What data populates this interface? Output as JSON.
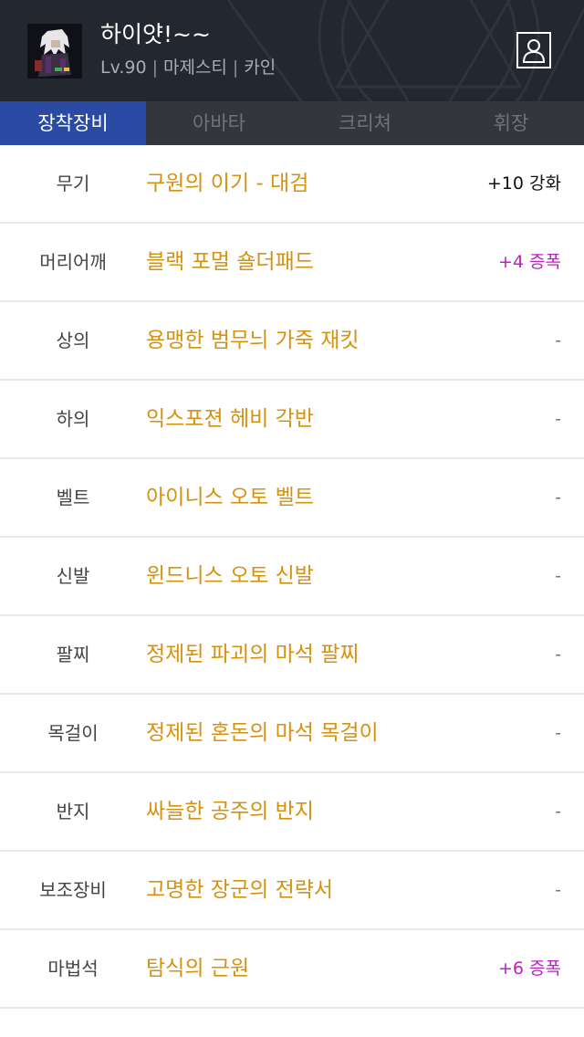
{
  "header": {
    "character_name": "하이얏!~~",
    "level": "Lv.90",
    "job": "마제스티",
    "server": "카인",
    "separator": "|",
    "profile_icon": "profile-icon"
  },
  "tabs": [
    {
      "label": "장착장비",
      "active": true
    },
    {
      "label": "아바타",
      "active": false
    },
    {
      "label": "크리쳐",
      "active": false
    },
    {
      "label": "휘장",
      "active": false
    }
  ],
  "colors": {
    "header_bg": "#23272f",
    "tab_bg": "#33373d",
    "tab_active": "#2a4aa3",
    "item_name": "#d6920e",
    "amplify": "#c01ec9"
  },
  "equipment": [
    {
      "slot": "무기",
      "item": "구원의 이기 - 대검",
      "status": "+10 강화",
      "type": "enchant"
    },
    {
      "slot": "머리어깨",
      "item": "블랙 포멀 숄더패드",
      "status": "+4 증폭",
      "type": "amplify"
    },
    {
      "slot": "상의",
      "item": "용맹한 범무늬 가죽 재킷",
      "status": "-",
      "type": "none"
    },
    {
      "slot": "하의",
      "item": "익스포젼 헤비 각반",
      "status": "-",
      "type": "none"
    },
    {
      "slot": "벨트",
      "item": "아이니스 오토 벨트",
      "status": "-",
      "type": "none"
    },
    {
      "slot": "신발",
      "item": "윈드니스 오토 신발",
      "status": "-",
      "type": "none"
    },
    {
      "slot": "팔찌",
      "item": "정제된 파괴의 마석 팔찌",
      "status": "-",
      "type": "none"
    },
    {
      "slot": "목걸이",
      "item": "정제된 혼돈의 마석 목걸이",
      "status": "-",
      "type": "none"
    },
    {
      "slot": "반지",
      "item": "싸늘한 공주의 반지",
      "status": "-",
      "type": "none"
    },
    {
      "slot": "보조장비",
      "item": "고명한 장군의 전략서",
      "status": "-",
      "type": "none"
    },
    {
      "slot": "마법석",
      "item": "탐식의 근원",
      "status": "+6 증폭",
      "type": "amplify"
    }
  ]
}
